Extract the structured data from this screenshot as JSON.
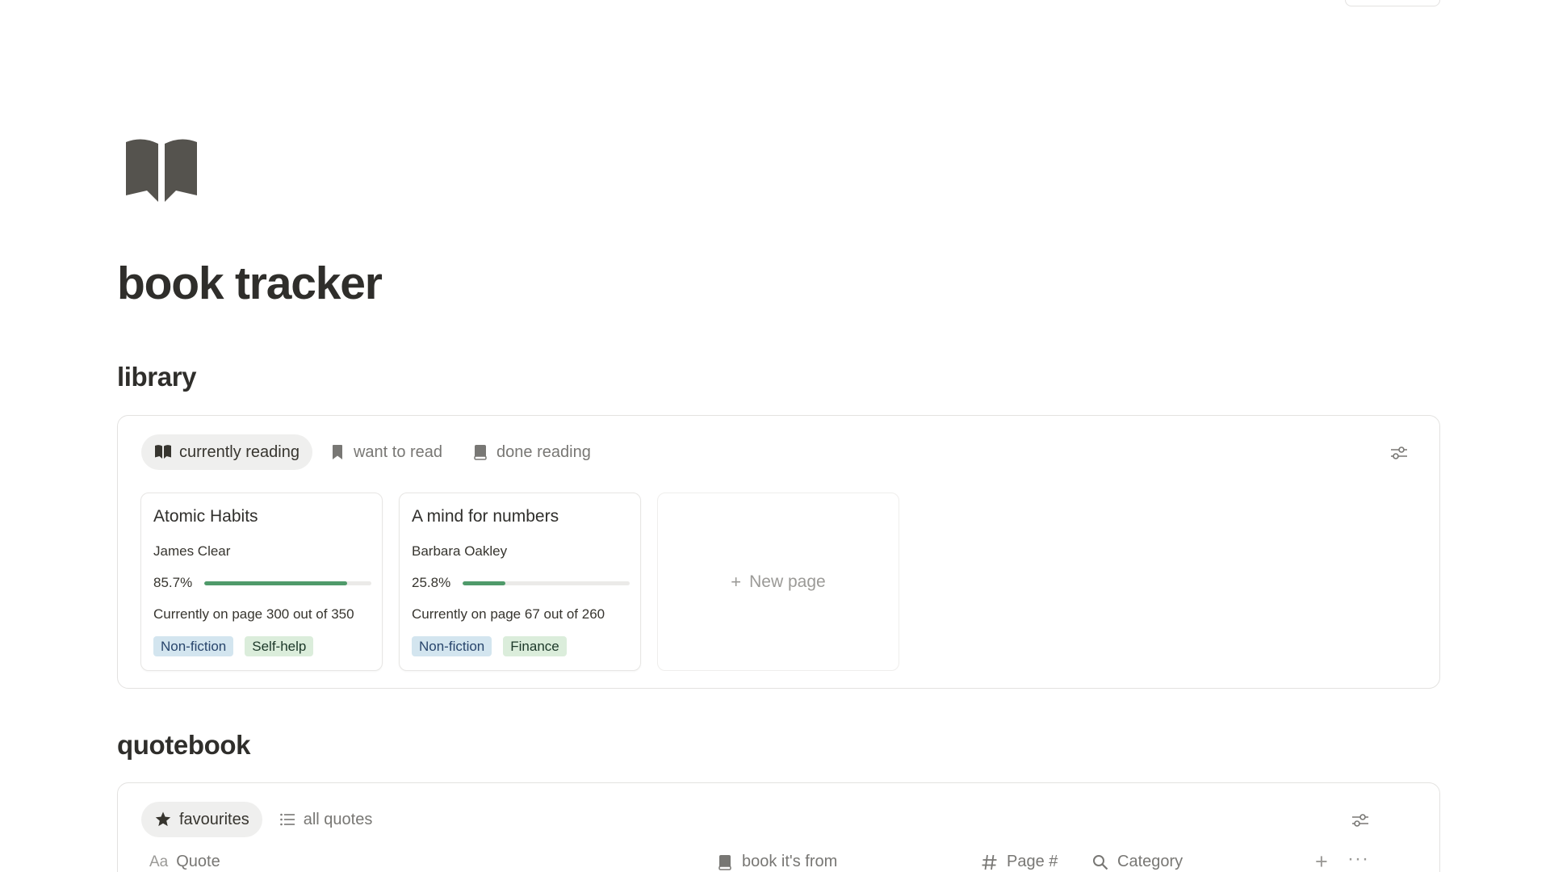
{
  "page": {
    "title": "book tracker",
    "icon": "open-book-icon"
  },
  "library": {
    "title": "library",
    "tabs": [
      {
        "label": "currently reading",
        "icon": "open-book-icon",
        "active": true
      },
      {
        "label": "want to read",
        "icon": "bookmark-icon",
        "active": false
      },
      {
        "label": "done reading",
        "icon": "closed-book-icon",
        "active": false
      }
    ],
    "cards": [
      {
        "title": "Atomic Habits",
        "author": "James Clear",
        "progress_label": "85.7%",
        "progress": 0.857,
        "page_text": "Currently on page 300 out of 350",
        "tags": [
          {
            "label": "Non-fiction",
            "color": "#d3e5ef"
          },
          {
            "label": "Self-help",
            "color": "#dbeddb"
          }
        ]
      },
      {
        "title": "A mind for numbers",
        "author": "Barbara Oakley",
        "progress_label": "25.8%",
        "progress": 0.258,
        "page_text": "Currently on page 67 out of 260",
        "tags": [
          {
            "label": "Non-fiction",
            "color": "#d3e5ef"
          },
          {
            "label": "Finance",
            "color": "#dbeddb"
          }
        ]
      }
    ],
    "new_page_label": "New page",
    "new_page_plus": "+"
  },
  "quotebook": {
    "title": "quotebook",
    "tabs": [
      {
        "label": "favourites",
        "icon": "star-icon",
        "active": true
      },
      {
        "label": "all quotes",
        "icon": "list-icon",
        "active": false
      }
    ],
    "columns": [
      {
        "label": "Quote",
        "prefix": "Aa"
      },
      {
        "label": "book it's from",
        "icon": "closed-book-icon"
      },
      {
        "label": "Page #",
        "icon": "hash-icon"
      },
      {
        "label": "Category",
        "icon": "search-icon"
      }
    ],
    "add_symbol": "+",
    "more_symbol": "···"
  },
  "colors": {
    "progress": "#4f9a6a",
    "text": "#37352f",
    "muted": "#787774"
  }
}
